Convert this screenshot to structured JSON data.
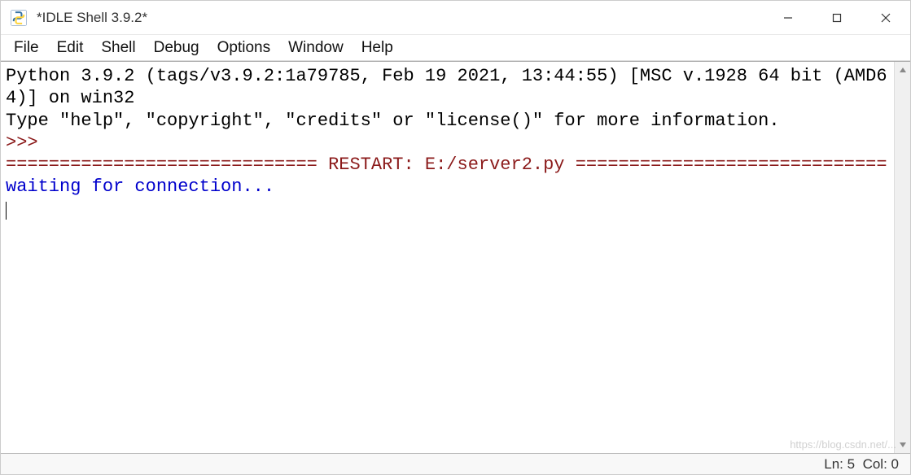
{
  "window": {
    "title": "*IDLE Shell 3.9.2*"
  },
  "menu": {
    "items": [
      "File",
      "Edit",
      "Shell",
      "Debug",
      "Options",
      "Window",
      "Help"
    ]
  },
  "shell": {
    "banner_line1": "Python 3.9.2 (tags/v3.9.2:1a79785, Feb 19 2021, 13:44:55) [MSC v.1928 64 bit (AMD64)] on win32",
    "banner_line2": "Type \"help\", \"copyright\", \"credits\" or \"license()\" for more information.",
    "prompt": ">>> ",
    "restart_line": "============================= RESTART: E:/server2.py =============================",
    "output1": "waiting for connection..."
  },
  "status": {
    "ln_label": "Ln:",
    "ln_value": "5",
    "col_label": "Col:",
    "col_value": "0"
  },
  "watermark": "https://blog.csdn.net/..."
}
